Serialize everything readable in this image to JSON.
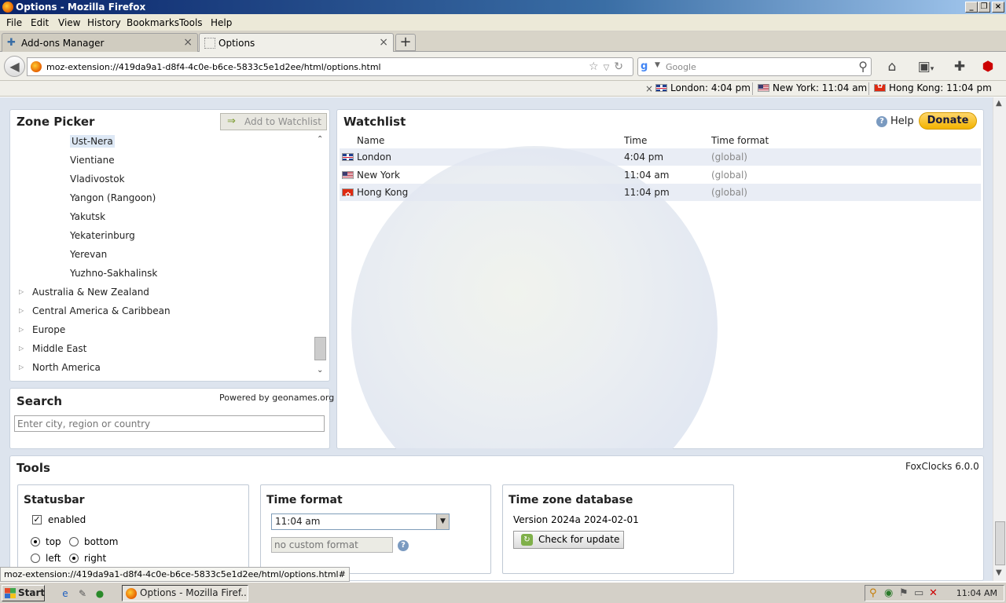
{
  "window": {
    "title": "Options - Mozilla Firefox"
  },
  "menu": [
    "File",
    "Edit",
    "View",
    "History",
    "Bookmarks",
    "Tools",
    "Help"
  ],
  "tabs": [
    {
      "label": "Add-ons Manager",
      "active": false
    },
    {
      "label": "Options",
      "active": true
    }
  ],
  "nav": {
    "url": "moz-extension://419da9a1-d8f4-4c0e-b6ce-5833c5e1d2ee/html/options.html",
    "search_placeholder": "Google"
  },
  "statusbar_clocks": [
    {
      "label": "London: 4:04 pm",
      "flag": "uk"
    },
    {
      "label": "New York: 11:04 am",
      "flag": "us"
    },
    {
      "label": "Hong Kong: 11:04 pm",
      "flag": "hk"
    }
  ],
  "zone_picker": {
    "title": "Zone Picker",
    "add_button": "Add to Watchlist",
    "cities": [
      "Ust-Nera",
      "Vientiane",
      "Vladivostok",
      "Yangon (Rangoon)",
      "Yakutsk",
      "Yekaterinburg",
      "Yerevan",
      "Yuzhno-Sakhalinsk"
    ],
    "selected_city": "Ust-Nera",
    "regions": [
      "Australia & New Zealand",
      "Central America & Caribbean",
      "Europe",
      "Middle East",
      "North America"
    ]
  },
  "search": {
    "title": "Search",
    "powered_by": "Powered by geonames.org",
    "placeholder": "Enter city, region or country"
  },
  "watchlist": {
    "title": "Watchlist",
    "help_label": "Help",
    "donate_label": "Donate",
    "columns": {
      "name": "Name",
      "time": "Time",
      "format": "Time format"
    },
    "rows": [
      {
        "name": "London",
        "time": "4:04 pm",
        "format": "(global)",
        "flag": "uk"
      },
      {
        "name": "New York",
        "time": "11:04 am",
        "format": "(global)",
        "flag": "us"
      },
      {
        "name": "Hong Kong",
        "time": "11:04 pm",
        "format": "(global)",
        "flag": "hk"
      }
    ]
  },
  "tools": {
    "title": "Tools",
    "version": "FoxClocks 6.0.0",
    "statusbar": {
      "title": "Statusbar",
      "enabled_label": "enabled",
      "enabled": true,
      "top_label": "top",
      "bottom_label": "bottom",
      "left_label": "left",
      "right_label": "right",
      "position_vertical": "top",
      "position_horizontal": "right"
    },
    "time_format": {
      "title": "Time format",
      "selected": "11:04 am",
      "custom_placeholder": "no custom format"
    },
    "tz_database": {
      "title": "Time zone database",
      "version_label": "Version 2024a",
      "date": "2024-02-01",
      "update_button": "Check for update"
    }
  },
  "status_url": "moz-extension://419da9a1-d8f4-4c0e-b6ce-5833c5e1d2ee/html/options.html#",
  "taskbar": {
    "start_label": "Start",
    "task_label": "Options - Mozilla Firef...",
    "clock": "11:04 AM"
  },
  "colors": {
    "page_background": "#dde4ee",
    "donate": "#f2b300",
    "selection": "#dde8f5"
  }
}
